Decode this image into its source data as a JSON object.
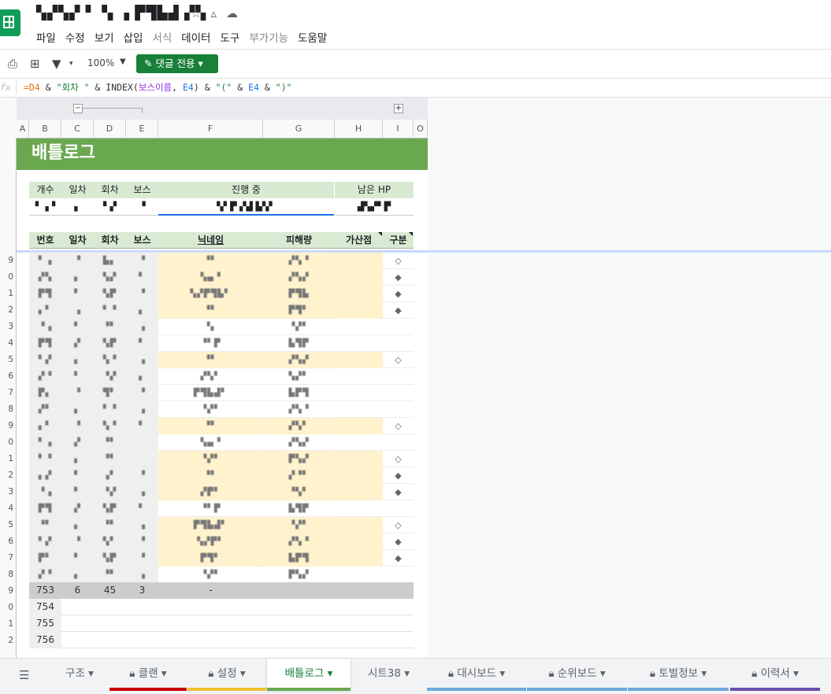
{
  "doc": {
    "title": "▚▞▚▞ ▘▝▖▗ ▛▜▙▟ ▞▚"
  },
  "title_icons": [
    "star-icon",
    "drive-icon",
    "cloud-icon"
  ],
  "menu": [
    "파일",
    "수정",
    "보기",
    "삽입",
    "서식",
    "데이터",
    "도구",
    "부가기능",
    "도움말"
  ],
  "toolbar": {
    "zoom": "100%",
    "comment_mode": "댓글 전용"
  },
  "formula": {
    "fx": "fx",
    "p1": "=D4",
    "p2": " & ",
    "p3": "\"회차 \"",
    "p4": " & INDEX(",
    "p5": "보스이름",
    "p6": ", ",
    "p7": "E4",
    "p8": ") & ",
    "p9": "\"(\"",
    "p10": " & ",
    "p11": "E4",
    "p12": " & ",
    "p13": "\")\""
  },
  "columns": [
    "A",
    "B",
    "C",
    "D",
    "E",
    "F",
    "G",
    "H",
    "I",
    "O"
  ],
  "row_numbers": [
    "",
    "",
    "",
    "",
    "",
    "",
    "9",
    "0",
    "1",
    "2",
    "3",
    "4",
    "5",
    "6",
    "7",
    "8",
    "9",
    "0",
    "1",
    "2",
    "3",
    "4",
    "5",
    "6",
    "7",
    "8",
    "9",
    "0",
    "1",
    "2"
  ],
  "banner": "배틀로그",
  "summary": {
    "headers": [
      "개수",
      "일차",
      "회차",
      "보스",
      "진행 중",
      "남은 HP"
    ],
    "values": [
      "▘▗▝",
      "▖",
      "▘▞",
      "▝",
      "▚▘▛ ▞▟ ▙▚▘",
      "▟▚▞▘▛"
    ]
  },
  "table": {
    "headers": [
      "번호",
      "일차",
      "회차",
      "보스",
      "닉네임",
      "피해량",
      "가산점",
      "구분"
    ],
    "rows": [
      {
        "c": [
          "▘▗",
          "▝",
          "▙▖",
          "▝",
          "▝▘",
          "▞▚▝"
        ],
        "mark": "◇",
        "y": true
      },
      {
        "c": [
          "▞▚",
          "▖",
          "▚▞",
          "▘",
          "▚▄▝",
          "▞▚▞"
        ],
        "mark": "◆",
        "y": true
      },
      {
        "c": [
          "▛▜",
          "▘",
          "▚▛",
          "▝",
          "▚▞▛▜▙▘",
          "▛▜▙"
        ],
        "mark": "◆",
        "y": true
      },
      {
        "c": [
          "▖▘",
          "▗",
          "▘▝",
          "▖",
          "▝▘",
          "▛▜▘"
        ],
        "mark": "◆",
        "y": true
      },
      {
        "c": [
          "▝▗",
          "▘",
          "▝▘",
          "▗",
          "▝▖",
          "▝▞▘"
        ],
        "mark": "",
        "y": false
      },
      {
        "c": [
          "▛▜",
          "▞",
          "▚▛",
          "▘",
          "▝▘▛",
          "▙▜▛"
        ],
        "mark": "",
        "y": false
      },
      {
        "c": [
          "▘▞",
          "▖",
          "▚▝",
          "▗",
          "▝▘",
          "▞▚▞"
        ],
        "mark": "◇",
        "y": true
      },
      {
        "c": [
          "▞▝",
          "▘",
          "▝▞",
          "▖",
          "▞▚▘",
          "▚▞▘"
        ],
        "mark": "",
        "y": false
      },
      {
        "c": [
          "▛▖",
          "▝",
          "▜▘",
          "▝",
          "▛▜▙▟▘",
          "▙▛▜"
        ],
        "mark": "",
        "y": false
      },
      {
        "c": [
          "▞▘",
          "▖",
          "▘▝",
          "▗",
          "▝▞▘",
          "▞▚▝"
        ],
        "mark": "",
        "y": false
      },
      {
        "c": [
          "▖▘",
          "▝",
          "▚▝",
          "▘",
          "▝▘",
          "▞▚▘"
        ],
        "mark": "◇",
        "y": true
      },
      {
        "c": [
          "▘▗",
          "▞",
          "▝▘",
          "",
          "▚▄▝",
          "▞▚▞"
        ],
        "mark": "",
        "y": false
      },
      {
        "c": [
          "▘▝",
          "▖",
          "▝▘",
          "",
          "▝▞▘",
          "▛▚▞"
        ],
        "mark": "◇",
        "y": true
      },
      {
        "c": [
          "▖▞",
          "▘",
          "▗▘",
          "▝",
          "▝▘",
          "▞▝▘"
        ],
        "mark": "◆",
        "y": true
      },
      {
        "c": [
          "▝▗",
          "▘",
          "▝▞",
          "▗",
          "▞▛▘",
          "▝▚▘"
        ],
        "mark": "◆",
        "y": true
      },
      {
        "c": [
          "▛▜",
          "▞",
          "▚▛",
          "▘",
          "▝▘▛",
          "▙▜▛"
        ],
        "mark": "",
        "y": false
      },
      {
        "c": [
          "▝▘",
          "▖",
          "▝▘",
          "▗",
          "▛▜▙▟▘",
          "▝▞▘"
        ],
        "mark": "◇",
        "y": true
      },
      {
        "c": [
          "▘▞",
          "▝",
          "▚▘",
          "▝",
          "▚▞▛▘",
          "▞▚▝"
        ],
        "mark": "◆",
        "y": true
      },
      {
        "c": [
          "▛▘",
          "▘",
          "▚▛",
          "▝",
          "▛▜▘",
          "▙▛▜"
        ],
        "mark": "◆",
        "y": true
      },
      {
        "c": [
          "▞▝",
          "▖",
          "▝▘",
          "▗",
          "▝▞▘",
          "▛▚▞"
        ],
        "mark": "",
        "y": false
      }
    ],
    "sum_row": {
      "no": "753",
      "day": "6",
      "round": "45",
      "boss": "3",
      "nick": "-"
    },
    "after_rows": [
      "754",
      "755",
      "756"
    ]
  },
  "tabs": [
    {
      "label": "구조",
      "lock": false,
      "color": ""
    },
    {
      "label": "클랜",
      "lock": true,
      "color": "#cc0000"
    },
    {
      "label": "설정",
      "lock": true,
      "color": "#f1c232"
    },
    {
      "label": "배틀로그",
      "lock": false,
      "color": "#6aa84f"
    },
    {
      "label": "시트38",
      "lock": false,
      "color": ""
    },
    {
      "label": "대시보드",
      "lock": true,
      "color": "#6fa8dc"
    },
    {
      "label": "순위보드",
      "lock": true,
      "color": "#6fa8dc"
    },
    {
      "label": "토벌정보",
      "lock": true,
      "color": "#6fa8dc"
    },
    {
      "label": "이력서",
      "lock": true,
      "color": "#674ea7"
    }
  ]
}
